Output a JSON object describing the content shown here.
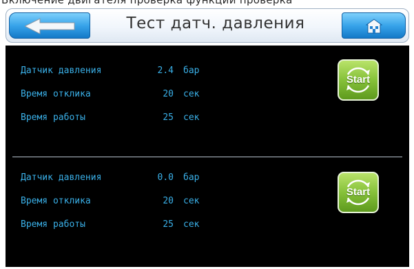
{
  "top_strip": {
    "text": "Включение двигателя проверка функции проверка"
  },
  "header": {
    "title": "Тест датч. давления",
    "back_icon": "arrow-left-icon",
    "home_icon": "home-icon"
  },
  "sensors": [
    {
      "rows": [
        {
          "label": "Датчик давления",
          "value": "2.4",
          "unit": "бар"
        },
        {
          "label": "Время отклика",
          "value": "20",
          "unit": "сек"
        },
        {
          "label": "Время работы",
          "value": "25",
          "unit": "сек"
        }
      ],
      "start_label": "Start"
    },
    {
      "rows": [
        {
          "label": "Датчик давления",
          "value": "0.0",
          "unit": "бар"
        },
        {
          "label": "Время отклика",
          "value": "20",
          "unit": "сек"
        },
        {
          "label": "Время работы",
          "value": "25",
          "unit": "сек"
        }
      ],
      "start_label": "Start"
    }
  ],
  "colors": {
    "panel_bg": "#000000",
    "text_blue": "#3ab0e8",
    "button_blue": "#38a4ea",
    "start_green": "#86c13a"
  }
}
